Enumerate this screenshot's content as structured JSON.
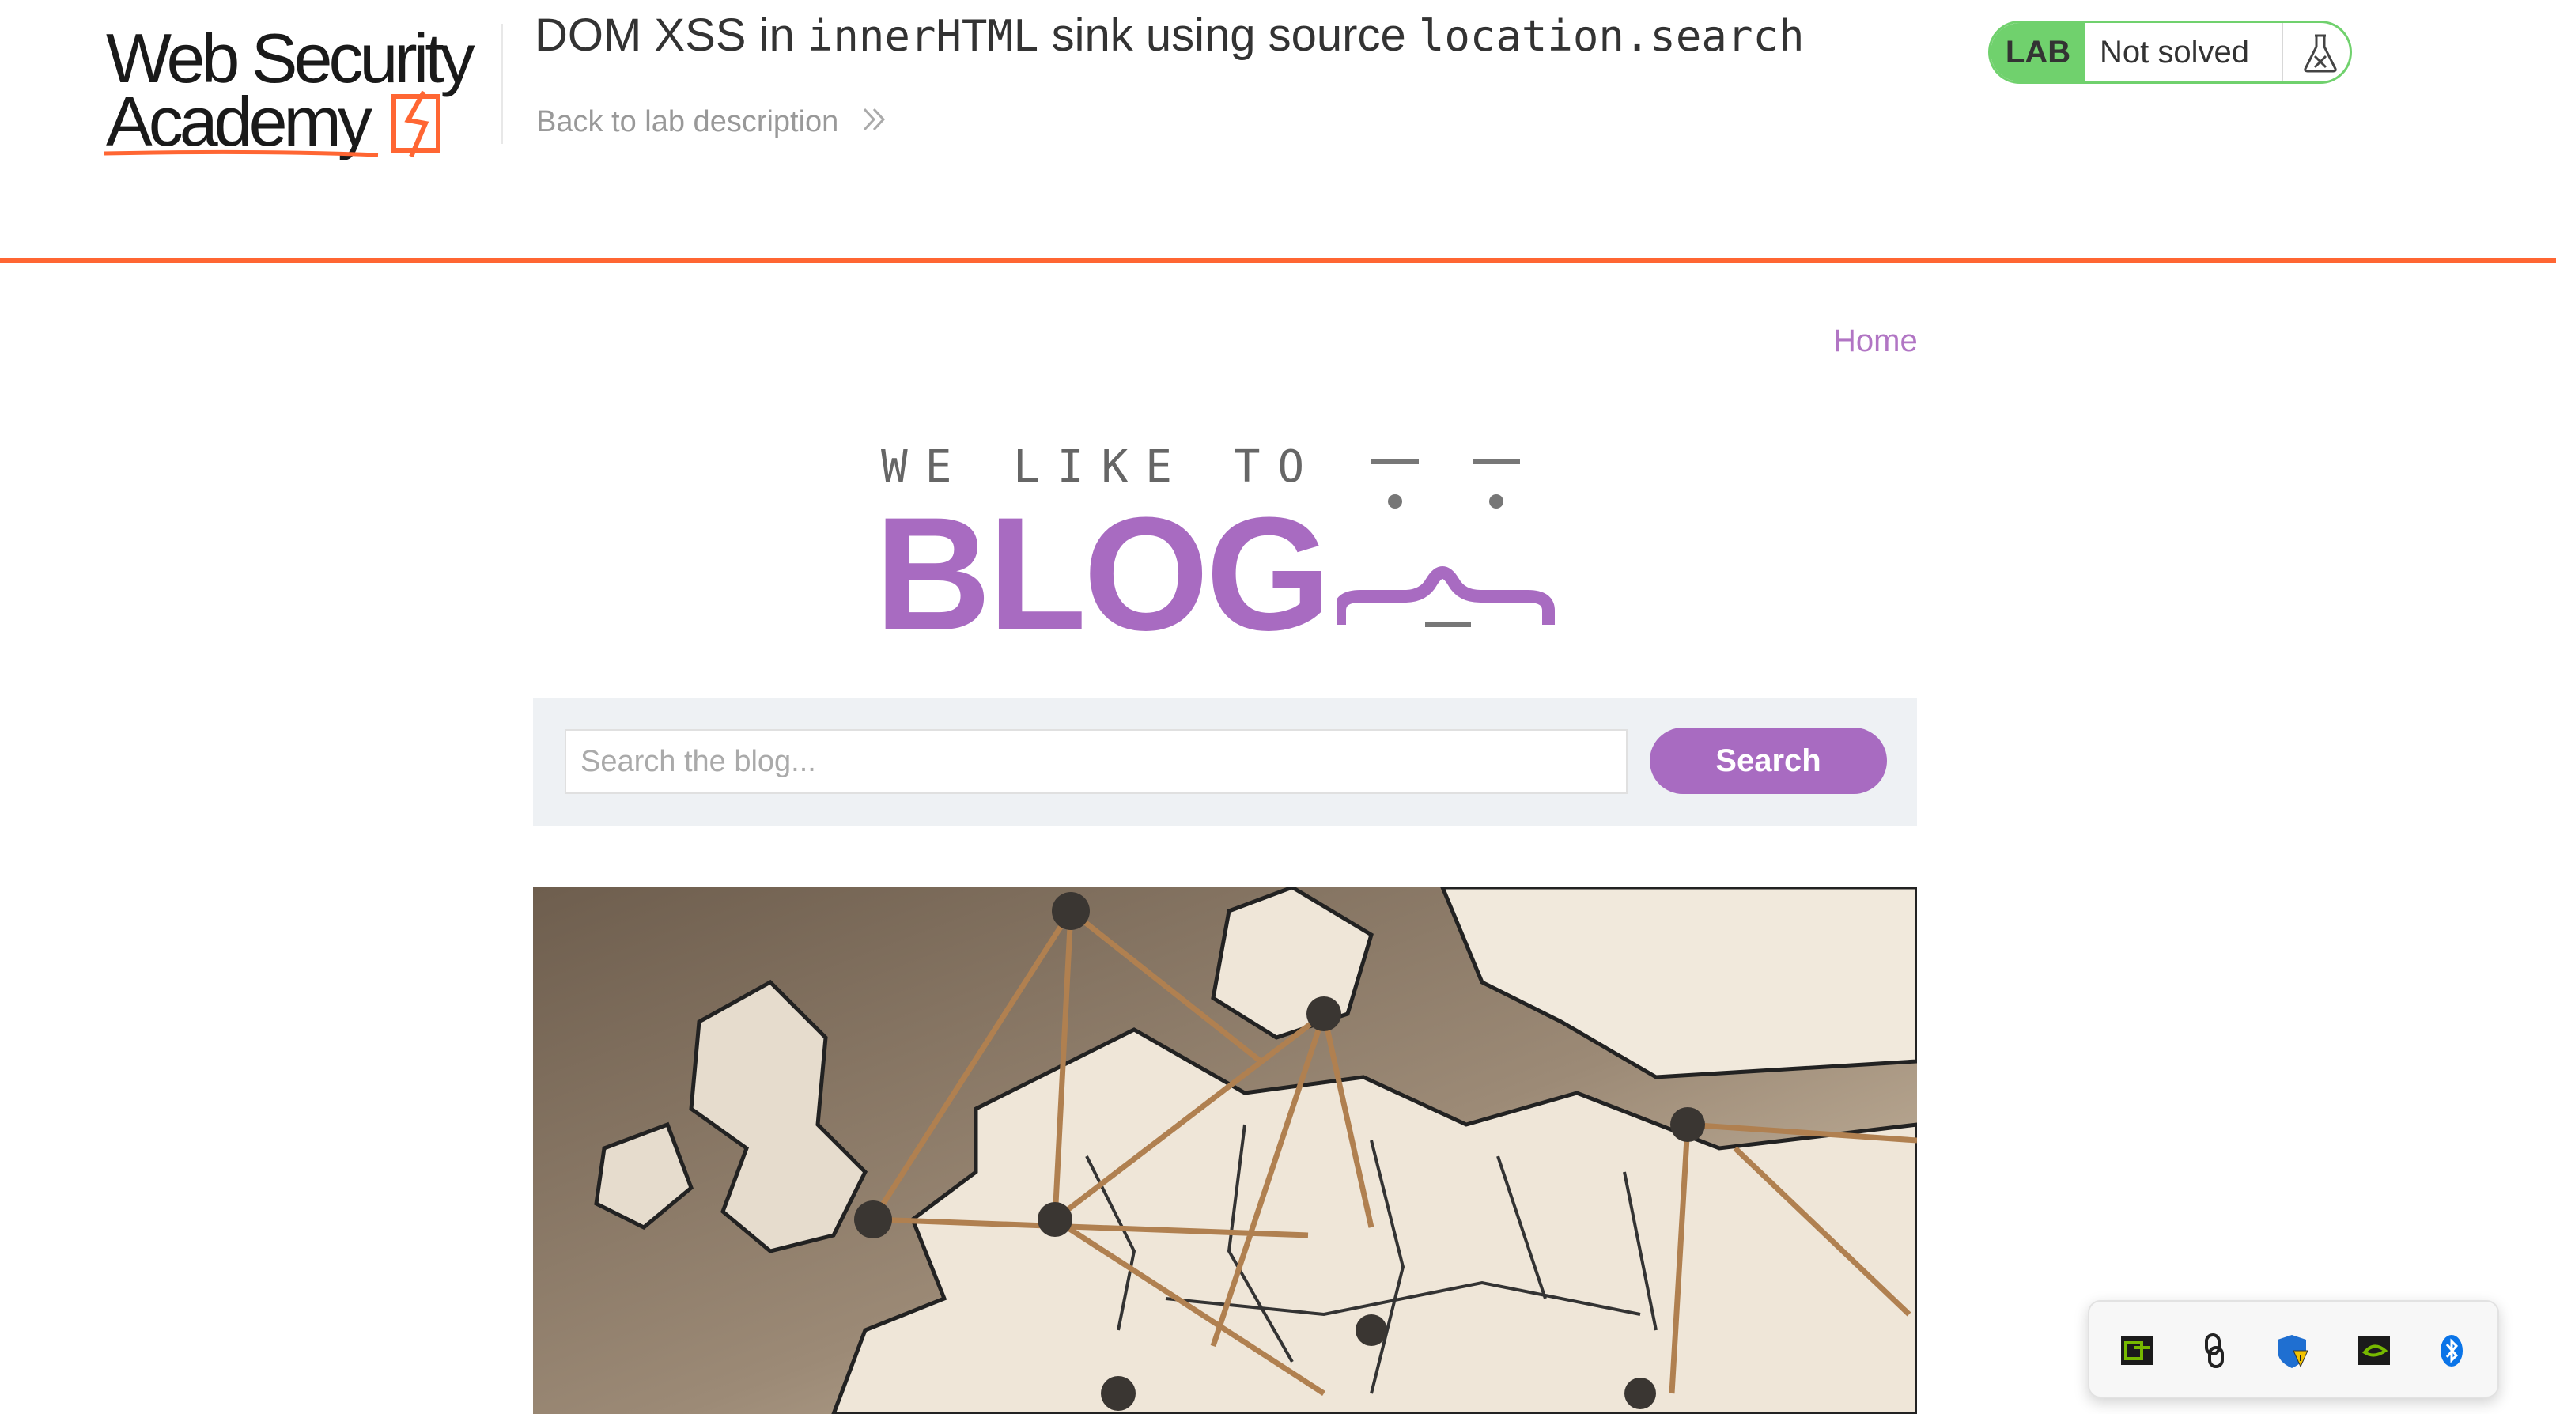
{
  "header": {
    "logo": {
      "line1": "Web Security",
      "line2": "Academy"
    },
    "title_prefix": "DOM XSS in ",
    "title_code1": "innerHTML",
    "title_middle": " sink using source ",
    "title_code2": "location.search",
    "back_link": "Back to lab description",
    "lab_badge": "LAB",
    "lab_status": "Not solved"
  },
  "blog": {
    "nav_home": "Home",
    "tagline": "WE LIKE TO",
    "wordmark": "BLOG",
    "search": {
      "placeholder": "Search the blog...",
      "button": "Search"
    },
    "post_image_alt": "Map of Europe with pins and string"
  },
  "tray": {
    "icons": [
      "nvidia-geforce-icon",
      "chain-link-icon",
      "windows-security-warning-icon",
      "nvidia-icon",
      "bluetooth-icon"
    ]
  },
  "colors": {
    "accent_orange": "#ff6633",
    "blog_purple": "#a86bc1",
    "link_purple": "#b175c4",
    "lab_green": "#70d16d"
  }
}
